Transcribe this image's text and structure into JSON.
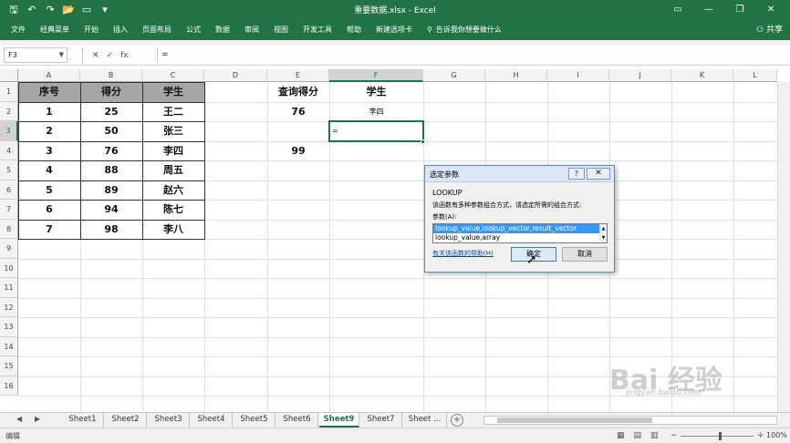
{
  "title_bar": {
    "document_title": "重要数据.xlsx - Excel",
    "qat_icons": [
      "save-icon",
      "undo-icon",
      "redo-icon",
      "open-icon",
      "new-icon",
      "customize-icon"
    ]
  },
  "ribbon": {
    "tabs": [
      "文件",
      "经典菜单",
      "开始",
      "插入",
      "页面布局",
      "公式",
      "数据",
      "审阅",
      "视图",
      "开发工具",
      "帮助",
      "新建选项卡"
    ],
    "tell_me": "告诉我你想要做什么",
    "share": "共享"
  },
  "formula_bar": {
    "name_box": "F3",
    "fx": "fx",
    "content": "="
  },
  "columns": [
    "A",
    "B",
    "C",
    "D",
    "E",
    "F",
    "G",
    "H",
    "I",
    "J",
    "K",
    "L"
  ],
  "rows": [
    "1",
    "2",
    "3",
    "4",
    "5",
    "6",
    "7",
    "8",
    "9",
    "10",
    "11",
    "12",
    "13",
    "14",
    "15",
    "16"
  ],
  "table": {
    "headers": [
      "序号",
      "得分",
      "学生"
    ],
    "rows": [
      [
        "1",
        "25",
        "王二"
      ],
      [
        "2",
        "50",
        "张三"
      ],
      [
        "3",
        "76",
        "李四"
      ],
      [
        "4",
        "88",
        "周五"
      ],
      [
        "5",
        "89",
        "赵六"
      ],
      [
        "6",
        "94",
        "陈七"
      ],
      [
        "7",
        "98",
        "李八"
      ]
    ]
  },
  "query": {
    "e1": "查询得分",
    "f1": "学生",
    "e2": "76",
    "f2": "李四",
    "f3": "=",
    "e4": "99"
  },
  "dialog": {
    "title": "选定参数",
    "help": "?",
    "close": "✕",
    "function_name": "LOOKUP",
    "description": "该函数有多种参数组合方式，请选定所需的组合方式:",
    "param_label": "参数(A):",
    "options": [
      "lookup_value,lookup_vector,result_vector",
      "lookup_value,array"
    ],
    "help_link": "有关该函数的帮助(H)",
    "ok": "确定",
    "cancel": "取消"
  },
  "sheets": {
    "tabs": [
      "Sheet1",
      "Sheet2",
      "Sheet3",
      "Sheet4",
      "Sheet5",
      "Sheet6",
      "Sheet9",
      "Sheet7",
      "Sheet ..."
    ],
    "active": "Sheet9",
    "add": "+"
  },
  "status": {
    "mode": "编辑",
    "zoom": "100%"
  },
  "watermark": {
    "text": "Bai 经验",
    "sub": "jingyan.baidu.com"
  }
}
